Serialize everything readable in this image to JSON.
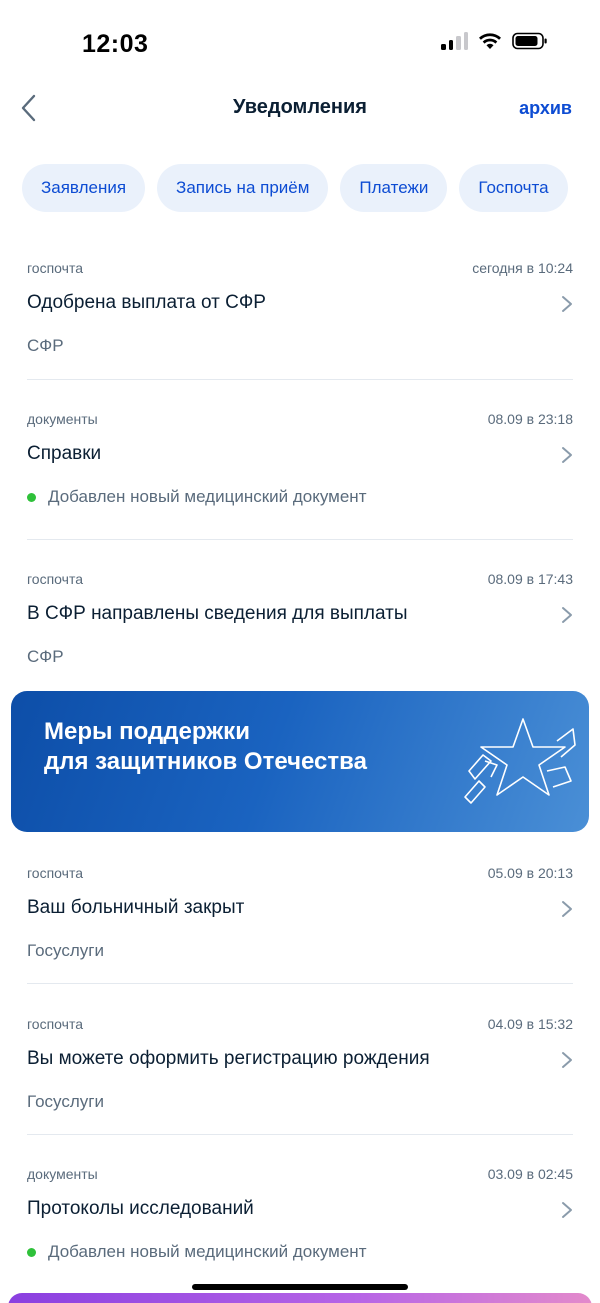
{
  "status_bar": {
    "time": "12:03"
  },
  "nav": {
    "title": "Уведомления",
    "archive_label": "архив"
  },
  "chips": [
    "Заявления",
    "Запись на приём",
    "Платежи",
    "Госпочта"
  ],
  "notifications": [
    {
      "category": "госпочта",
      "date": "сегодня в 10:24",
      "title": "Одобрена выплата от СФР",
      "subtitle": "СФР",
      "has_dot": false
    },
    {
      "category": "документы",
      "date": "08.09 в 23:18",
      "title": "Справки",
      "subtitle": "Добавлен новый медицинский документ",
      "has_dot": true
    },
    {
      "category": "госпочта",
      "date": "08.09 в 17:43",
      "title": "В СФР направлены сведения для выплаты",
      "subtitle": "СФР",
      "has_dot": false
    },
    {
      "category": "госпочта",
      "date": "05.09 в 20:13",
      "title": "Ваш больничный закрыт",
      "subtitle": "Госуслуги",
      "has_dot": false
    },
    {
      "category": "госпочта",
      "date": "04.09 в 15:32",
      "title": "Вы можете оформить регистрацию рождения",
      "subtitle": "Госуслуги",
      "has_dot": false
    },
    {
      "category": "документы",
      "date": "03.09 в 02:45",
      "title": "Протоколы исследований",
      "subtitle": "Добавлен новый медицинский документ",
      "has_dot": true
    }
  ],
  "banner": {
    "line1": "Меры поддержки",
    "line2": "для защитников Отечества",
    "icon": "star-icon"
  },
  "colors": {
    "accent": "#0d4cd3",
    "chip_bg": "#eaf1fb",
    "dot_green": "#2fc13a",
    "banner_blue": "#1a63c0"
  }
}
